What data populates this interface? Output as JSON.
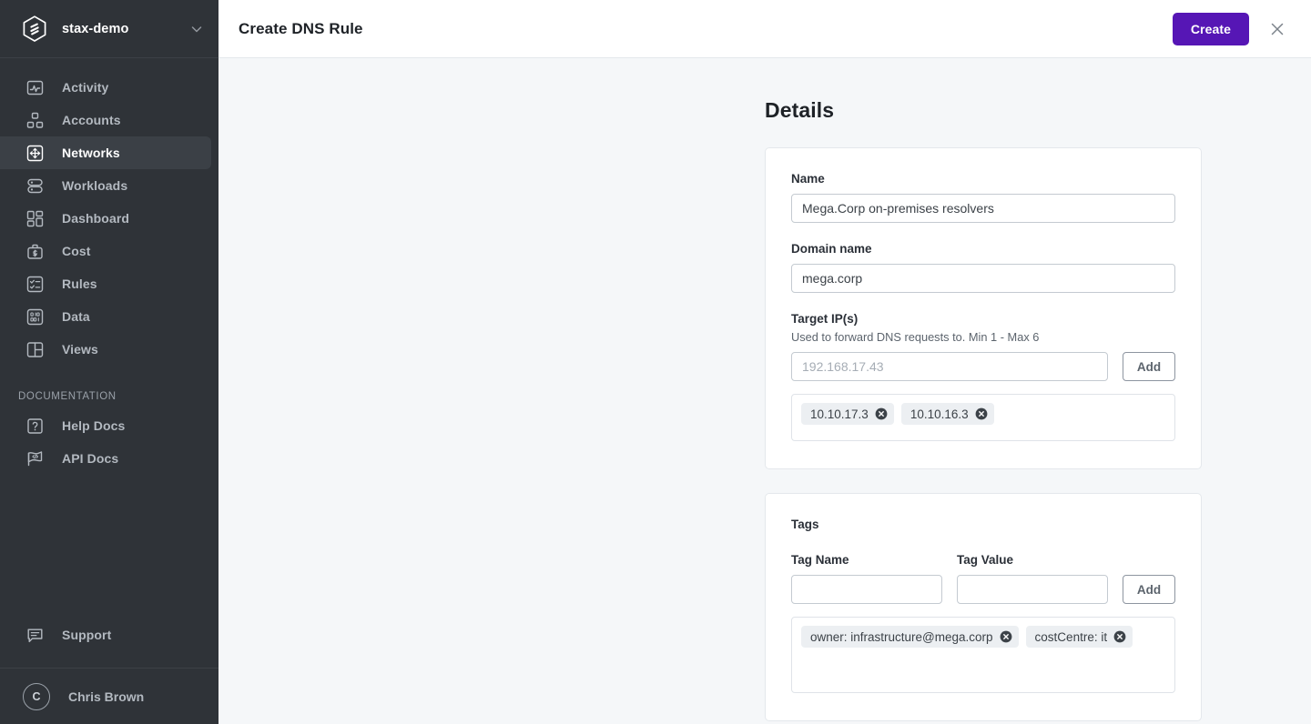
{
  "sidebar": {
    "org": {
      "name": "stax-demo",
      "logo_icon": "stax-hexagon-logo",
      "chevron_icon": "chevron-down-icon"
    },
    "items": [
      {
        "label": "Activity",
        "icon": "activity-chart-icon",
        "active": false
      },
      {
        "label": "Accounts",
        "icon": "accounts-blocks-icon",
        "active": false
      },
      {
        "label": "Networks",
        "icon": "networks-move-icon",
        "active": true
      },
      {
        "label": "Workloads",
        "icon": "workloads-stack-icon",
        "active": false
      },
      {
        "label": "Dashboard",
        "icon": "dashboard-grid-icon",
        "active": false
      },
      {
        "label": "Cost",
        "icon": "cost-briefcase-dollar-icon",
        "active": false
      },
      {
        "label": "Rules",
        "icon": "rules-checklist-icon",
        "active": false
      },
      {
        "label": "Data",
        "icon": "data-binary-icon",
        "active": false
      },
      {
        "label": "Views",
        "icon": "views-panel-icon",
        "active": false
      }
    ],
    "documentation_heading": "DOCUMENTATION",
    "doc_items": [
      {
        "label": "Help Docs",
        "icon": "help-question-icon"
      },
      {
        "label": "API Docs",
        "icon": "api-code-flag-icon"
      }
    ],
    "support": {
      "label": "Support",
      "icon": "support-chat-icon"
    },
    "user": {
      "name": "Chris Brown",
      "initial": "C"
    }
  },
  "topbar": {
    "title": "Create DNS Rule",
    "create_label": "Create",
    "close_icon": "close-x-icon"
  },
  "details": {
    "heading": "Details",
    "name": {
      "label": "Name",
      "value": "Mega.Corp on-premises resolvers",
      "placeholder": ""
    },
    "domain_name": {
      "label": "Domain name",
      "value": "mega.corp",
      "placeholder": ""
    },
    "target_ips": {
      "label": "Target IP(s)",
      "help": "Used to forward DNS requests to. Min 1 - Max 6",
      "value": "",
      "placeholder": "192.168.17.43",
      "add_label": "Add",
      "chips": [
        "10.10.17.3",
        "10.10.16.3"
      ]
    }
  },
  "tags": {
    "heading": "Tags",
    "tag_name": {
      "label": "Tag Name",
      "value": "",
      "placeholder": ""
    },
    "tag_value": {
      "label": "Tag Value",
      "value": "",
      "placeholder": ""
    },
    "add_label": "Add",
    "chips": [
      "owner: infrastructure@mega.corp",
      "costCentre: it"
    ]
  },
  "colors": {
    "sidebar_bg": "#2f3338",
    "accent_purple": "#5616b5",
    "page_bg": "#f5f7f9",
    "card_bg": "#ffffff",
    "chip_bg": "#eceff2"
  }
}
